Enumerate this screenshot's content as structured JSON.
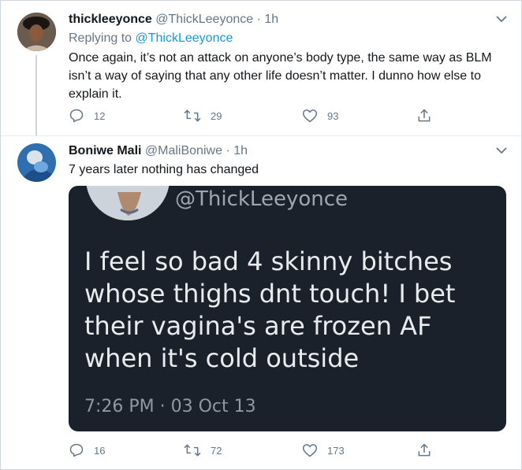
{
  "tweets": [
    {
      "name": "thickleeyonce",
      "handle": "@ThickLeeyonce",
      "dot": "·",
      "time": "1h",
      "replying_prefix": "Replying to",
      "replying_handle": "@ThickLeeyonce",
      "text": "Once again, it’s not an attack on anyone’s body type, the same way as BLM isn’t a way of saying that any other life doesn’t matter. I dunno how else to explain it.",
      "replies": "12",
      "retweets": "29",
      "likes": "93"
    },
    {
      "name": "Boniwe Mali",
      "handle": "@MaliBoniwe",
      "dot": "·",
      "time": "1h",
      "text": "7 years later nothing has changed",
      "embed": {
        "handle": "@ThickLeeyonce",
        "text": "I feel so bad 4 skinny bitches whose thighs dnt touch! I bet their vagina's are frozen AF when it's cold outside",
        "time": "7:26 PM · 03 Oct 13"
      },
      "replies": "16",
      "retweets": "72",
      "likes": "173"
    }
  ],
  "icons": [
    "reply-icon",
    "retweet-icon",
    "like-icon",
    "share-icon",
    "chevron-down-icon"
  ],
  "colors": {
    "link": "#1b95e0",
    "muted": "#657786",
    "embed_bg": "#1b212b"
  }
}
